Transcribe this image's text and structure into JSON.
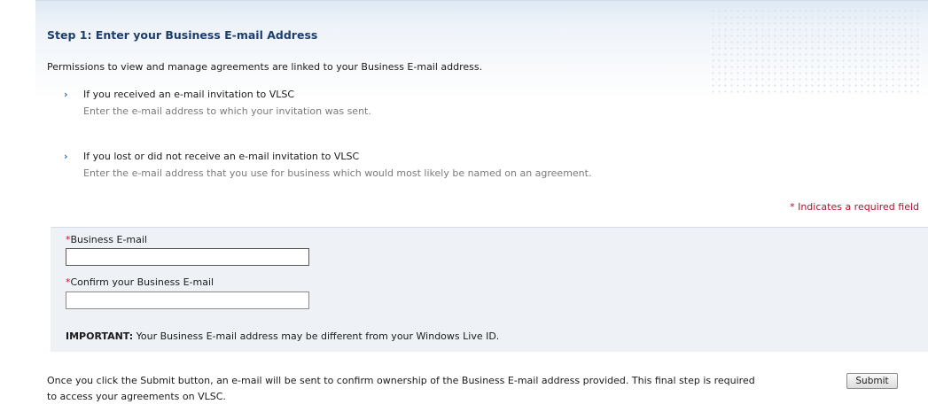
{
  "step": {
    "title": "Step 1: Enter your Business E-mail Address",
    "intro": "Permissions to view and manage agreements are linked to your Business E-mail address."
  },
  "options": [
    {
      "icon": "chevron-right-icon",
      "glyph": "›",
      "heading": "If you received an e-mail invitation to VLSC",
      "description": "Enter the e-mail address to which your invitation was sent."
    },
    {
      "icon": "chevron-right-icon",
      "glyph": "›",
      "heading": "If you lost or did not receive an e-mail invitation to VLSC",
      "description": "Enter the e-mail address that you use for business which would most likely be named on an agreement."
    }
  ],
  "required_note": "* Indicates a required field",
  "form": {
    "required_marker": "*",
    "email_label": "Business E-mail",
    "email_value": "",
    "confirm_label": "Confirm your Business E-mail",
    "confirm_value": "",
    "important_label": "IMPORTANT:",
    "important_text": " Your Business E-mail address may be different from your Windows Live ID."
  },
  "footer": {
    "text": "Once you click the Submit button, an e-mail will be sent to confirm ownership of the Business E-mail address provided. This final step is required to access your agreements on VLSC.",
    "submit_label": "Submit"
  },
  "colors": {
    "title": "#1d3f6e",
    "required": "#c0102a",
    "panel": "#eef2f7",
    "chevron": "#2e6fae"
  }
}
